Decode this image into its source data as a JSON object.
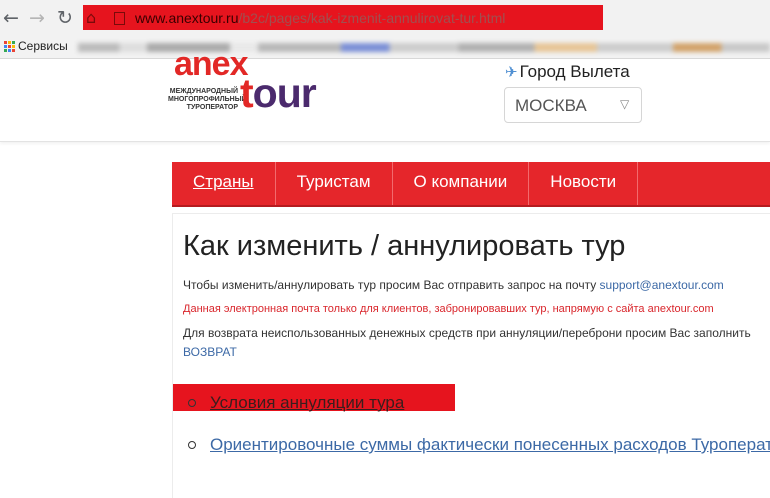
{
  "browser": {
    "url_host": "www.anextour.ru",
    "url_path": "/b2c/pages/kak-izmenit-annulirovat-tur.html",
    "bookmarks_label": "Сервисы",
    "icons": {
      "back": "back-arrow-icon",
      "forward": "forward-arrow-icon",
      "reload": "reload-icon",
      "home": "home-icon",
      "page": "page-icon",
      "apps": "apps-grid-icon"
    }
  },
  "header": {
    "logo_top": "anex",
    "logo_tagline": "МЕЖДУНАРОДНЫЙ МНОГОПРОФИЛЬНЫЙ ТУРОПЕРАТОР",
    "logo_tour_t": "t",
    "logo_tour_rest": "our",
    "city_label": "Город Вылета",
    "city_value": "МОСКВА"
  },
  "nav": {
    "items": [
      "Страны",
      "Туристам",
      "О компании",
      "Новости"
    ]
  },
  "main": {
    "title": "Как изменить / аннулировать тур",
    "line1_text": "Чтобы изменить/аннулировать тур просим Вас отправить запрос на почту ",
    "line1_email": "support@anextour.com",
    "line2": "Данная электронная почта только для клиентов, забронировавших тур, напрямую с сайта anextour.com",
    "line3": "Для возврата неиспользованных денежных средств при аннуляции/переброни просим Вас заполнить",
    "line4": "ВОЗВРАТ",
    "list": [
      "Условия аннуляции тура",
      "Ориентировочные суммы фактически понесенных расходов Туроператора"
    ]
  },
  "colors": {
    "brand_red": "#e5262b",
    "brand_purple": "#4b2a6d",
    "link_blue": "#3c69a6",
    "redaction": "#e6141e"
  }
}
